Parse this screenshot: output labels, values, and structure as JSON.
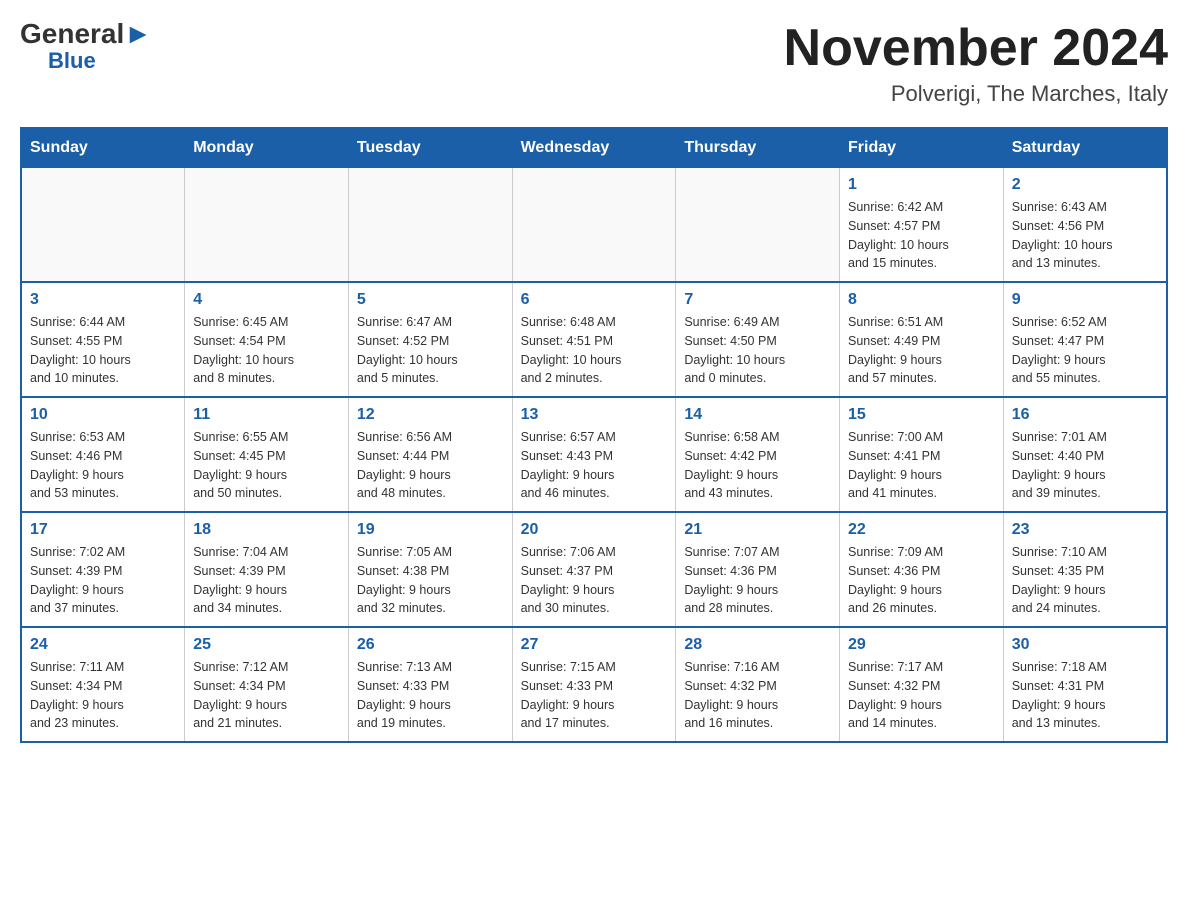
{
  "header": {
    "logo_general": "General",
    "logo_blue": "Blue",
    "month_title": "November 2024",
    "location": "Polverigi, The Marches, Italy"
  },
  "days_of_week": [
    "Sunday",
    "Monday",
    "Tuesday",
    "Wednesday",
    "Thursday",
    "Friday",
    "Saturday"
  ],
  "weeks": [
    [
      {
        "day": "",
        "info": ""
      },
      {
        "day": "",
        "info": ""
      },
      {
        "day": "",
        "info": ""
      },
      {
        "day": "",
        "info": ""
      },
      {
        "day": "",
        "info": ""
      },
      {
        "day": "1",
        "info": "Sunrise: 6:42 AM\nSunset: 4:57 PM\nDaylight: 10 hours\nand 15 minutes."
      },
      {
        "day": "2",
        "info": "Sunrise: 6:43 AM\nSunset: 4:56 PM\nDaylight: 10 hours\nand 13 minutes."
      }
    ],
    [
      {
        "day": "3",
        "info": "Sunrise: 6:44 AM\nSunset: 4:55 PM\nDaylight: 10 hours\nand 10 minutes."
      },
      {
        "day": "4",
        "info": "Sunrise: 6:45 AM\nSunset: 4:54 PM\nDaylight: 10 hours\nand 8 minutes."
      },
      {
        "day": "5",
        "info": "Sunrise: 6:47 AM\nSunset: 4:52 PM\nDaylight: 10 hours\nand 5 minutes."
      },
      {
        "day": "6",
        "info": "Sunrise: 6:48 AM\nSunset: 4:51 PM\nDaylight: 10 hours\nand 2 minutes."
      },
      {
        "day": "7",
        "info": "Sunrise: 6:49 AM\nSunset: 4:50 PM\nDaylight: 10 hours\nand 0 minutes."
      },
      {
        "day": "8",
        "info": "Sunrise: 6:51 AM\nSunset: 4:49 PM\nDaylight: 9 hours\nand 57 minutes."
      },
      {
        "day": "9",
        "info": "Sunrise: 6:52 AM\nSunset: 4:47 PM\nDaylight: 9 hours\nand 55 minutes."
      }
    ],
    [
      {
        "day": "10",
        "info": "Sunrise: 6:53 AM\nSunset: 4:46 PM\nDaylight: 9 hours\nand 53 minutes."
      },
      {
        "day": "11",
        "info": "Sunrise: 6:55 AM\nSunset: 4:45 PM\nDaylight: 9 hours\nand 50 minutes."
      },
      {
        "day": "12",
        "info": "Sunrise: 6:56 AM\nSunset: 4:44 PM\nDaylight: 9 hours\nand 48 minutes."
      },
      {
        "day": "13",
        "info": "Sunrise: 6:57 AM\nSunset: 4:43 PM\nDaylight: 9 hours\nand 46 minutes."
      },
      {
        "day": "14",
        "info": "Sunrise: 6:58 AM\nSunset: 4:42 PM\nDaylight: 9 hours\nand 43 minutes."
      },
      {
        "day": "15",
        "info": "Sunrise: 7:00 AM\nSunset: 4:41 PM\nDaylight: 9 hours\nand 41 minutes."
      },
      {
        "day": "16",
        "info": "Sunrise: 7:01 AM\nSunset: 4:40 PM\nDaylight: 9 hours\nand 39 minutes."
      }
    ],
    [
      {
        "day": "17",
        "info": "Sunrise: 7:02 AM\nSunset: 4:39 PM\nDaylight: 9 hours\nand 37 minutes."
      },
      {
        "day": "18",
        "info": "Sunrise: 7:04 AM\nSunset: 4:39 PM\nDaylight: 9 hours\nand 34 minutes."
      },
      {
        "day": "19",
        "info": "Sunrise: 7:05 AM\nSunset: 4:38 PM\nDaylight: 9 hours\nand 32 minutes."
      },
      {
        "day": "20",
        "info": "Sunrise: 7:06 AM\nSunset: 4:37 PM\nDaylight: 9 hours\nand 30 minutes."
      },
      {
        "day": "21",
        "info": "Sunrise: 7:07 AM\nSunset: 4:36 PM\nDaylight: 9 hours\nand 28 minutes."
      },
      {
        "day": "22",
        "info": "Sunrise: 7:09 AM\nSunset: 4:36 PM\nDaylight: 9 hours\nand 26 minutes."
      },
      {
        "day": "23",
        "info": "Sunrise: 7:10 AM\nSunset: 4:35 PM\nDaylight: 9 hours\nand 24 minutes."
      }
    ],
    [
      {
        "day": "24",
        "info": "Sunrise: 7:11 AM\nSunset: 4:34 PM\nDaylight: 9 hours\nand 23 minutes."
      },
      {
        "day": "25",
        "info": "Sunrise: 7:12 AM\nSunset: 4:34 PM\nDaylight: 9 hours\nand 21 minutes."
      },
      {
        "day": "26",
        "info": "Sunrise: 7:13 AM\nSunset: 4:33 PM\nDaylight: 9 hours\nand 19 minutes."
      },
      {
        "day": "27",
        "info": "Sunrise: 7:15 AM\nSunset: 4:33 PM\nDaylight: 9 hours\nand 17 minutes."
      },
      {
        "day": "28",
        "info": "Sunrise: 7:16 AM\nSunset: 4:32 PM\nDaylight: 9 hours\nand 16 minutes."
      },
      {
        "day": "29",
        "info": "Sunrise: 7:17 AM\nSunset: 4:32 PM\nDaylight: 9 hours\nand 14 minutes."
      },
      {
        "day": "30",
        "info": "Sunrise: 7:18 AM\nSunset: 4:31 PM\nDaylight: 9 hours\nand 13 minutes."
      }
    ]
  ]
}
